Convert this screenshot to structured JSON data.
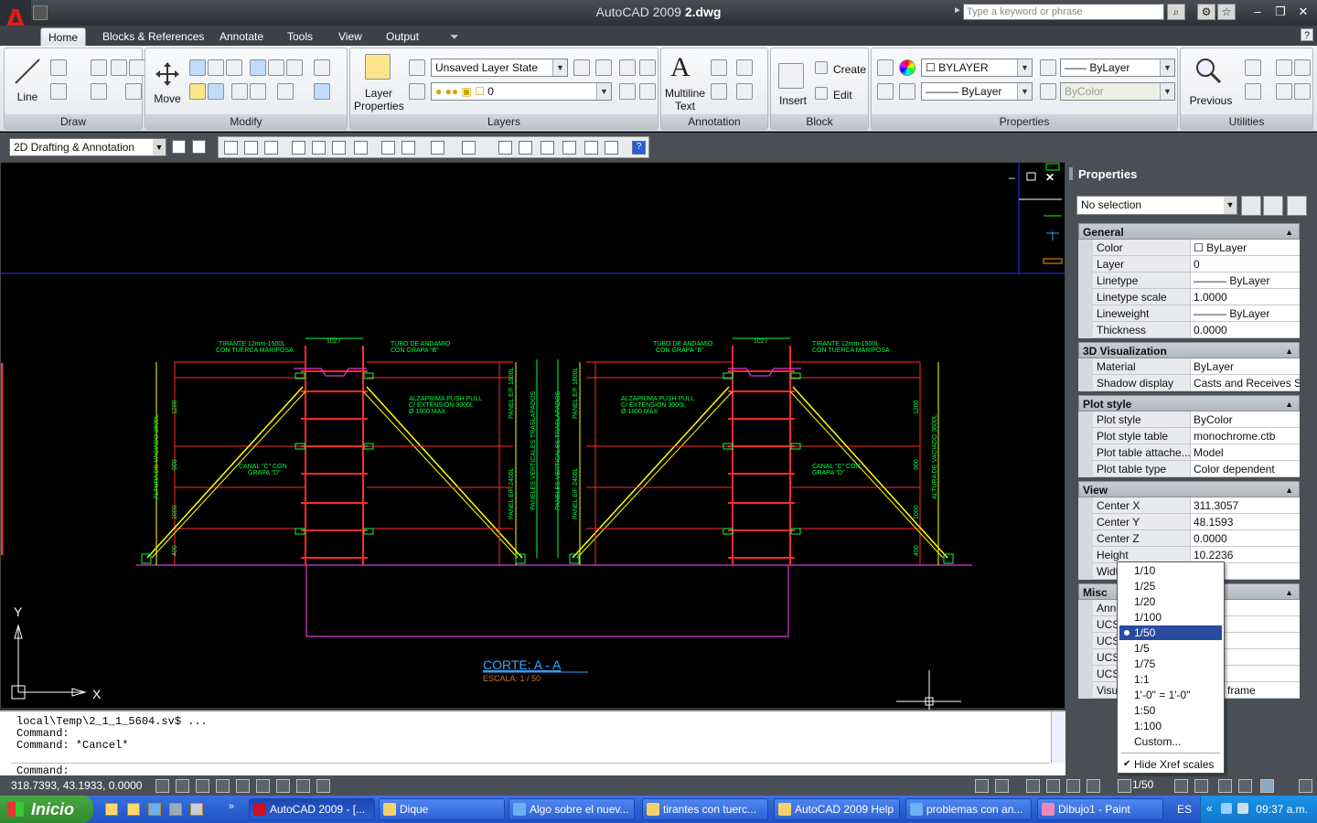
{
  "window": {
    "title_prefix": "AutoCAD 2009",
    "title_file": "2.dwg",
    "search_placeholder": "Type a keyword or phrase",
    "logo_letter": "A"
  },
  "ribbon_tabs": [
    "Home",
    "Blocks & References",
    "Annotate",
    "Tools",
    "View",
    "Output"
  ],
  "panels": {
    "draw": {
      "title": "Draw",
      "line_label": "Line"
    },
    "modify": {
      "title": "Modify",
      "move_label": "Move"
    },
    "layers": {
      "title": "Layers",
      "layer_props_label": "Layer\nProperties",
      "layer_state": "Unsaved Layer State",
      "current_layer": "0"
    },
    "annotation": {
      "title": "Annotation",
      "mtext_label": "Multiline\nText"
    },
    "block": {
      "title": "Block",
      "insert_label": "Insert",
      "create_label": "Create",
      "edit_label": "Edit"
    },
    "properties": {
      "title": "Properties",
      "color": "BYLAYER",
      "lineweight": "ByLayer",
      "linetype": "ByLayer",
      "plotstyle": "ByColor"
    },
    "utilities": {
      "title": "Utilities",
      "previous_label": "Previous"
    }
  },
  "workspace": "2D Drafting & Annotation",
  "drawing": {
    "section_title": "CORTE: A - A",
    "scale_text": "ESCALA: 1 / 50",
    "axis_x": "X",
    "axis_y": "Y",
    "labels": {
      "tirante_l": "TIRANTE 12mm-1500L",
      "tuerca_l": "CON TUERCA MARIPOSA",
      "tubo_l": "TUBO DE ANDAMIO",
      "grapa_l": "CON GRAPA \"B\"",
      "dim_top": "1027",
      "alzaprima_l": "ALZAPRIMA PUSH PULL",
      "ext_l": "C/ EXTENSION 3000L",
      "max_l": "Ø 1800 MAX",
      "canal_l": "CANAL \"C\" CON",
      "grapa_c": "GRAPA \"D\"",
      "altura": "ALTURA DE VACIADO 3600L",
      "panel_180": "PANEL E/F 1800L",
      "panel_240": "PANEL E/F 2400L",
      "paneles_v": "PANELES VERTICALES TRASLAPADOS",
      "dims_left": [
        "1200",
        "900",
        "1000",
        "400"
      ],
      "dims_mid": [
        "900",
        "600",
        "900",
        "600",
        "600",
        "900"
      ]
    }
  },
  "command": {
    "lines": [
      "local\\Temp\\2_1_1_5604.sv$ ...",
      "Command:",
      "Command: *Cancel*"
    ],
    "prompt": "Command:"
  },
  "status": {
    "coords": "318.7393, 43.1933, 0.0000",
    "annotation_scale": "1/50"
  },
  "properties_palette": {
    "title": "Properties",
    "selection": "No selection",
    "sections": [
      {
        "name": "General",
        "rows": [
          {
            "k": "Color",
            "v": "ByLayer"
          },
          {
            "k": "Layer",
            "v": "0"
          },
          {
            "k": "Linetype",
            "v": "ByLayer"
          },
          {
            "k": "Linetype scale",
            "v": "1.0000"
          },
          {
            "k": "Lineweight",
            "v": "ByLayer"
          },
          {
            "k": "Thickness",
            "v": "0.0000"
          }
        ]
      },
      {
        "name": "3D Visualization",
        "rows": [
          {
            "k": "Material",
            "v": "ByLayer"
          },
          {
            "k": "Shadow display",
            "v": "Casts and Receives S..."
          }
        ]
      },
      {
        "name": "Plot style",
        "rows": [
          {
            "k": "Plot style",
            "v": "ByColor"
          },
          {
            "k": "Plot style table",
            "v": "monochrome.ctb"
          },
          {
            "k": "Plot table attache...",
            "v": "Model"
          },
          {
            "k": "Plot table type",
            "v": "Color dependent"
          }
        ]
      },
      {
        "name": "View",
        "rows": [
          {
            "k": "Center X",
            "v": "311.3057"
          },
          {
            "k": "Center Y",
            "v": "48.1593"
          },
          {
            "k": "Center Z",
            "v": "0.0000"
          },
          {
            "k": "Height",
            "v": "10.2236"
          },
          {
            "k": "Width",
            "v": ""
          }
        ]
      },
      {
        "name": "Misc",
        "rows": [
          {
            "k": "Anno",
            "v": ""
          },
          {
            "k": "UCS",
            "v": ""
          },
          {
            "k": "UCS",
            "v": ""
          },
          {
            "k": "UCS",
            "v": ""
          },
          {
            "k": "UCS",
            "v": ""
          },
          {
            "k": "Visu",
            "v": "frame"
          }
        ]
      }
    ]
  },
  "scale_menu": {
    "options": [
      "1/10",
      "1/25",
      "1/20",
      "1/100",
      "1/50",
      "1/5",
      "1/75",
      "1:1",
      "1'-0\" = 1'-0\"",
      "1:50",
      "1:100",
      "Custom..."
    ],
    "selected_index": 4,
    "hide_xref": "Hide Xref scales"
  },
  "taskbar": {
    "start": "Inicio",
    "tasks": [
      "AutoCAD 2009 - [...",
      "Dique",
      "Algo sobre el nuev...",
      "tirantes con tuerc...",
      "AutoCAD 2009 Help",
      "problemas con an...",
      "Dibujo1 - Paint"
    ],
    "lang": "ES",
    "clock": "09:37 a.m."
  },
  "colors": {
    "red": "#ff2a2a",
    "yellow": "#ffff00",
    "green": "#00ff40",
    "magenta": "#d63cd6",
    "blue": "#2d2dff",
    "cyan": "#39a9ff"
  }
}
